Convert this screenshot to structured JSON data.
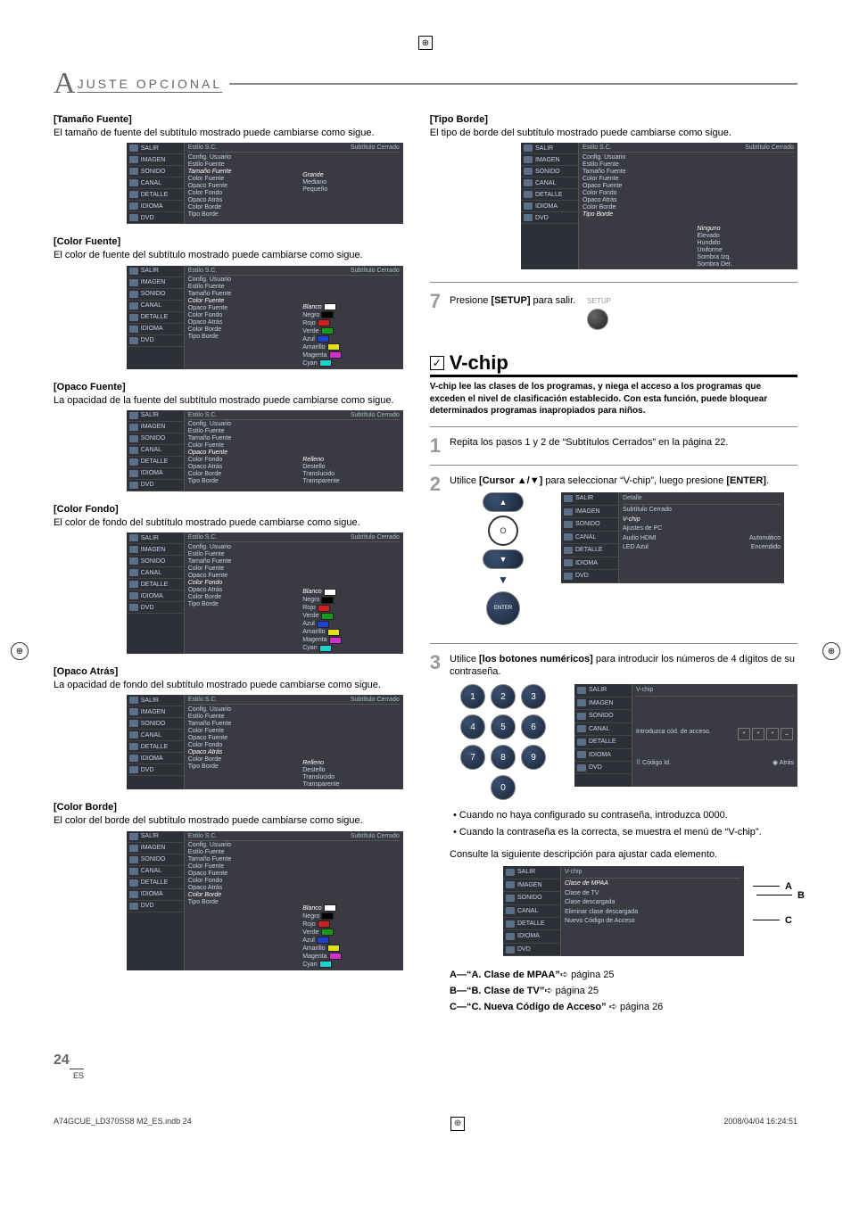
{
  "page": {
    "header_prefix": "A",
    "header_text": "JUSTE   OPCIONAL",
    "number": "24",
    "lang": "ES",
    "footer_left": "A74GCUE_LD370SS8 M2_ES.indb   24",
    "footer_right": "2008/04/04   16:24:51"
  },
  "osd_common": {
    "sidebar": [
      "SALIR",
      "IMAGEN",
      "SONIDO",
      "CANAL",
      "DETALLE",
      "IDIOMA",
      "DVD"
    ],
    "header_left": "Estilo S.C.",
    "header_right": "Subtítulo Cerrado",
    "items": [
      "Config. Usuario",
      "Estilo Fuente",
      "Tamaño Fuente",
      "Color Fuente",
      "Opaco Fuente",
      "Color Fondo",
      "Opaco Atrás",
      "Color Borde",
      "Tipo Borde"
    ]
  },
  "left_col": [
    {
      "title": "[Tamaño Fuente]",
      "desc": "El tamaño de fuente del subtítulo mostrado puede cambiarse como sigue.",
      "highlight": "Tamaño Fuente",
      "values": {
        "Tamaño Fuente": [
          "Grande",
          "Mediano",
          "Pequeño"
        ]
      },
      "hl_val": "Mediano",
      "colors": false
    },
    {
      "title": "[Color Fuente]",
      "desc": "El color de fuente del subtítulo mostrado puede cambiarse como sigue.",
      "highlight": "Color Fuente",
      "values": {
        "Color Fuente": [
          "Blanco",
          "Negro",
          "Rojo",
          "Verde",
          "Azul",
          "Amarillo",
          "Magenta",
          "Cyan"
        ]
      },
      "swatches": [
        "#ffffff",
        "#000000",
        "#d02020",
        "#1a9a1a",
        "#2040d0",
        "#e0e020",
        "#d030d0",
        "#20d0d0"
      ],
      "hl_val": "Blanco",
      "colors": true
    },
    {
      "title": "[Opaco Fuente]",
      "desc": "La opacidad de la fuente del subtítulo mostrado puede cambiarse como sigue.",
      "highlight": "Opaco Fuente",
      "values": {
        "Opaco Fuente": [
          "Relleno",
          "Destello",
          "Translucido",
          "Transparente"
        ]
      },
      "hl_val": "Relleno",
      "colors": false
    },
    {
      "title": "[Color Fondo]",
      "desc": "El color de fondo del subtítulo mostrado puede cambiarse como sigue.",
      "highlight": "Color Fondo",
      "values": {
        "Color Fondo": [
          "Blanco",
          "Negro",
          "Rojo",
          "Verde",
          "Azul",
          "Amarillo",
          "Magenta",
          "Cyan"
        ]
      },
      "swatches": [
        "#ffffff",
        "#000000",
        "#d02020",
        "#1a9a1a",
        "#2040d0",
        "#e0e020",
        "#d030d0",
        "#20d0d0"
      ],
      "hl_val": "Negro",
      "colors": true
    },
    {
      "title": "[Opaco Atrás]",
      "desc": "La opacidad de fondo del subtítulo mostrado puede cambiarse como sigue.",
      "highlight": "Opaco Atrás",
      "values": {
        "Opaco Atrás": [
          "Relleno",
          "Destello",
          "Translucido",
          "Transparente"
        ]
      },
      "hl_val": "Relleno",
      "colors": false
    },
    {
      "title": "[Color Borde]",
      "desc": "El color del borde del subtítulo mostrado puede cambiarse como sigue.",
      "highlight": "Color Borde",
      "values": {
        "Color Borde": [
          "Blanco",
          "Negro",
          "Rojo",
          "Verde",
          "Azul",
          "Amarillo",
          "Magenta",
          "Cyan"
        ]
      },
      "swatches": [
        "#ffffff",
        "#000000",
        "#d02020",
        "#1a9a1a",
        "#2040d0",
        "#e0e020",
        "#d030d0",
        "#20d0d0"
      ],
      "hl_val": "Negro",
      "colors": true
    }
  ],
  "right_col": {
    "tipo_borde": {
      "title": "[Tipo Borde]",
      "desc": "El tipo de borde del subtítulo mostrado puede cambiarse como sigue.",
      "highlight": "Tipo Borde",
      "values": {
        "Tipo Borde": [
          "Ninguno",
          "Elevado",
          "Hundido",
          "Uniforme",
          "Sombra Izq.",
          "Sombra Der."
        ]
      },
      "hl_val": "Ninguno"
    },
    "step7": {
      "num": "7",
      "text_pre": "Presione ",
      "text_bold": "[SETUP]",
      "text_post": " para salir.",
      "btn_label": "SETUP"
    },
    "vchip": {
      "check": "✓",
      "title": "V-chip",
      "intro": "V-chip lee las clases de los programas, y niega el acceso a los programas que exceden el nivel de clasificación establecido. Con esta función, puede bloquear determinados programas inapropiados para niños."
    },
    "step1": {
      "num": "1",
      "text": "Repita los pasos 1 y 2 de “Subtítulos Cerrados” en la página 22."
    },
    "step2": {
      "num": "2",
      "text_pre": "Utilice ",
      "text_bold1": "[Cursor ▲/▼]",
      "text_mid": " para seleccionar “V-chip”, luego presione ",
      "text_bold2": "[ENTER]",
      "text_post": ".",
      "remote": {
        "up": "▲",
        "circle": "O",
        "down": "▼",
        "tri": "▼",
        "enter": "ENTER"
      },
      "osd": {
        "header": "Detalle",
        "items": [
          "Subtítulo Cerrado",
          "V-chip",
          "Ajustes de PC",
          "Audio HDMI",
          "LED Azul"
        ],
        "highlight": "V-chip",
        "right": {
          "Audio HDMI": "Automático",
          "LED Azul": "Encendido"
        }
      }
    },
    "step3": {
      "num": "3",
      "text_pre": "Utilice ",
      "text_bold": "[los botones numéricos]",
      "text_post": " para introducir los números de 4 dígitos de su contraseña.",
      "numpad": [
        "1",
        "2",
        "3",
        "4",
        "5",
        "6",
        "7",
        "8",
        "9",
        "0"
      ],
      "osd": {
        "header": "V-chip",
        "prompt": "Introduzca cód. de acceso.",
        "mask": [
          "*",
          "*",
          "*",
          "–"
        ],
        "footer_left": "Código Id.",
        "footer_right": "Atrás"
      },
      "bullets": [
        "Cuando no haya configurado su contraseña, introduzca 0000.",
        "Cuando la contraseña es la correcta, se muestra el menú de “V-chip”."
      ],
      "consulte": "Consulte la siguiente descripción para ajustar cada elemento."
    },
    "step3_osd2": {
      "header": "V-chip",
      "items": [
        "Clase de MPAA",
        "Clase de TV",
        "Clase descargada",
        "Eliminar clase descargada",
        "Nuevo Código de Acceso"
      ],
      "highlight": "Clase de MPAA",
      "letters": [
        "A",
        "B",
        "C"
      ]
    },
    "refs": [
      {
        "prefix": "A—",
        "bold": "“A. Clase de MPAA”",
        "arrow": "➪",
        "tail": " página 25"
      },
      {
        "prefix": "B—",
        "bold": "“B. Clase de TV”",
        "arrow": "➪",
        "tail": " página 25"
      },
      {
        "prefix": "C—",
        "bold": "“C. Nueva Código de Acceso”",
        "arrow": " ➪",
        "tail": " página 26"
      }
    ]
  }
}
